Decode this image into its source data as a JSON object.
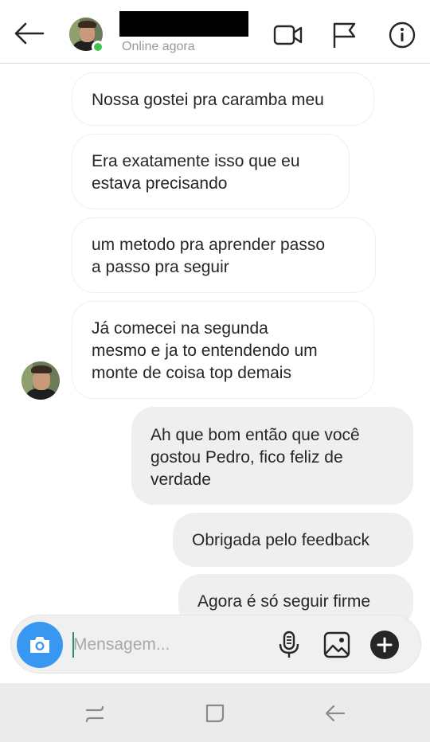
{
  "header": {
    "back_icon": "arrow-left-icon",
    "contact_name": "",
    "status": "Online agora",
    "video_icon": "video-camera-icon",
    "flag_icon": "flag-icon",
    "info_icon": "info-icon"
  },
  "messages": [
    {
      "direction": "incoming",
      "text": "Nossa gostei pra caramba meu"
    },
    {
      "direction": "incoming",
      "lines": [
        "Era exatamente isso que eu",
        "estava precisando"
      ]
    },
    {
      "direction": "incoming",
      "lines": [
        "um metodo pra aprender passo",
        "a passo pra seguir"
      ]
    },
    {
      "direction": "incoming",
      "lines": [
        "Já comecei na segunda",
        "mesmo e ja to entendendo um",
        "monte de coisa top demais"
      ]
    },
    {
      "direction": "outgoing",
      "lines": [
        "Ah que bom então que você",
        "gostou Pedro, fico feliz de",
        "verdade"
      ]
    },
    {
      "direction": "outgoing",
      "text": "Obrigada pelo feedback"
    },
    {
      "direction": "outgoing",
      "text": "Agora é só seguir firme"
    }
  ],
  "composer": {
    "placeholder": "Mensagem...",
    "value": "",
    "icons": [
      "camera-icon",
      "microphone-icon",
      "image-icon",
      "plus-icon"
    ]
  },
  "system_nav": {
    "icons": [
      "recents-icon",
      "home-icon",
      "back-icon"
    ]
  },
  "colors": {
    "online": "#44c152",
    "camera_button": "#3897f0",
    "outgoing_bubble": "#efefef",
    "incoming_border": "#efefef",
    "status_text": "#999999"
  }
}
